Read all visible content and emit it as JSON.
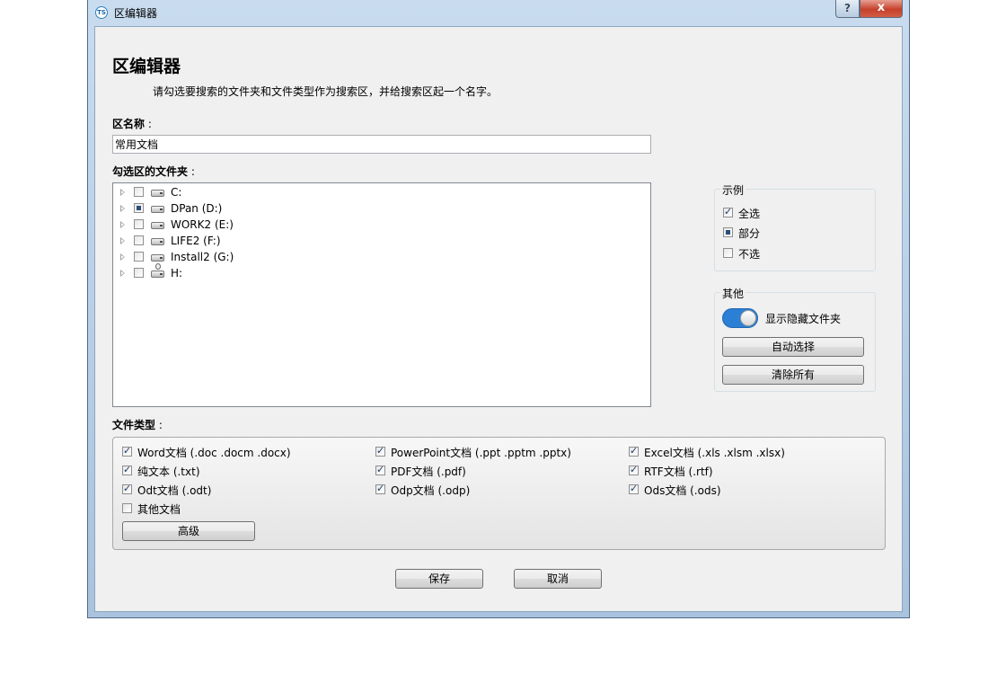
{
  "window": {
    "title": "区编辑器",
    "app_icon_text": "TS",
    "help_label": "?",
    "close_label": "x"
  },
  "header": {
    "title": "区编辑器",
    "subtitle": "请勾选要搜索的文件夹和文件类型作为搜索区，并给搜索区起一个名字。"
  },
  "zone_name": {
    "label": "区名称",
    "colon": " :",
    "value": "常用文档"
  },
  "folders": {
    "label": "勾选区的文件夹",
    "colon": " :",
    "drives": [
      {
        "label": "C:",
        "state": "unchecked",
        "icon": "drive-icon"
      },
      {
        "label": "DPan (D:)",
        "state": "partial",
        "icon": "drive-icon"
      },
      {
        "label": "WORK2 (E:)",
        "state": "unchecked",
        "icon": "drive-icon"
      },
      {
        "label": "LIFE2 (F:)",
        "state": "unchecked",
        "icon": "drive-icon"
      },
      {
        "label": "Install2 (G:)",
        "state": "unchecked",
        "icon": "drive-icon"
      },
      {
        "label": "H:",
        "state": "unchecked",
        "icon": "usb-drive-icon"
      }
    ]
  },
  "legend": {
    "title": "示例",
    "items": [
      {
        "label": "全选",
        "state": "checked"
      },
      {
        "label": "部分",
        "state": "partial"
      },
      {
        "label": "不选",
        "state": "unchecked"
      }
    ]
  },
  "other": {
    "title": "其他",
    "toggle_label": "显示隐藏文件夹",
    "toggle_on": true,
    "auto_select_label": "自动选择",
    "clear_all_label": "清除所有"
  },
  "file_types": {
    "label": "文件类型",
    "colon": " :",
    "items": [
      {
        "label": "Word文档 (.doc .docm .docx)",
        "checked": true
      },
      {
        "label": "PowerPoint文档 (.ppt .pptm .pptx)",
        "checked": true
      },
      {
        "label": "Excel文档 (.xls .xlsm .xlsx)",
        "checked": true
      },
      {
        "label": "纯文本 (.txt)",
        "checked": true
      },
      {
        "label": "PDF文档 (.pdf)",
        "checked": true
      },
      {
        "label": "RTF文档 (.rtf)",
        "checked": true
      },
      {
        "label": "Odt文档 (.odt)",
        "checked": true
      },
      {
        "label": "Odp文档 (.odp)",
        "checked": true
      },
      {
        "label": "Ods文档 (.ods)",
        "checked": true
      },
      {
        "label": "其他文档",
        "checked": false
      }
    ],
    "advanced_label": "高级"
  },
  "footer": {
    "save_label": "保存",
    "cancel_label": "取消"
  },
  "colors": {
    "toggle_accent": "#2b7fd4",
    "close_button": "#c6412c"
  }
}
